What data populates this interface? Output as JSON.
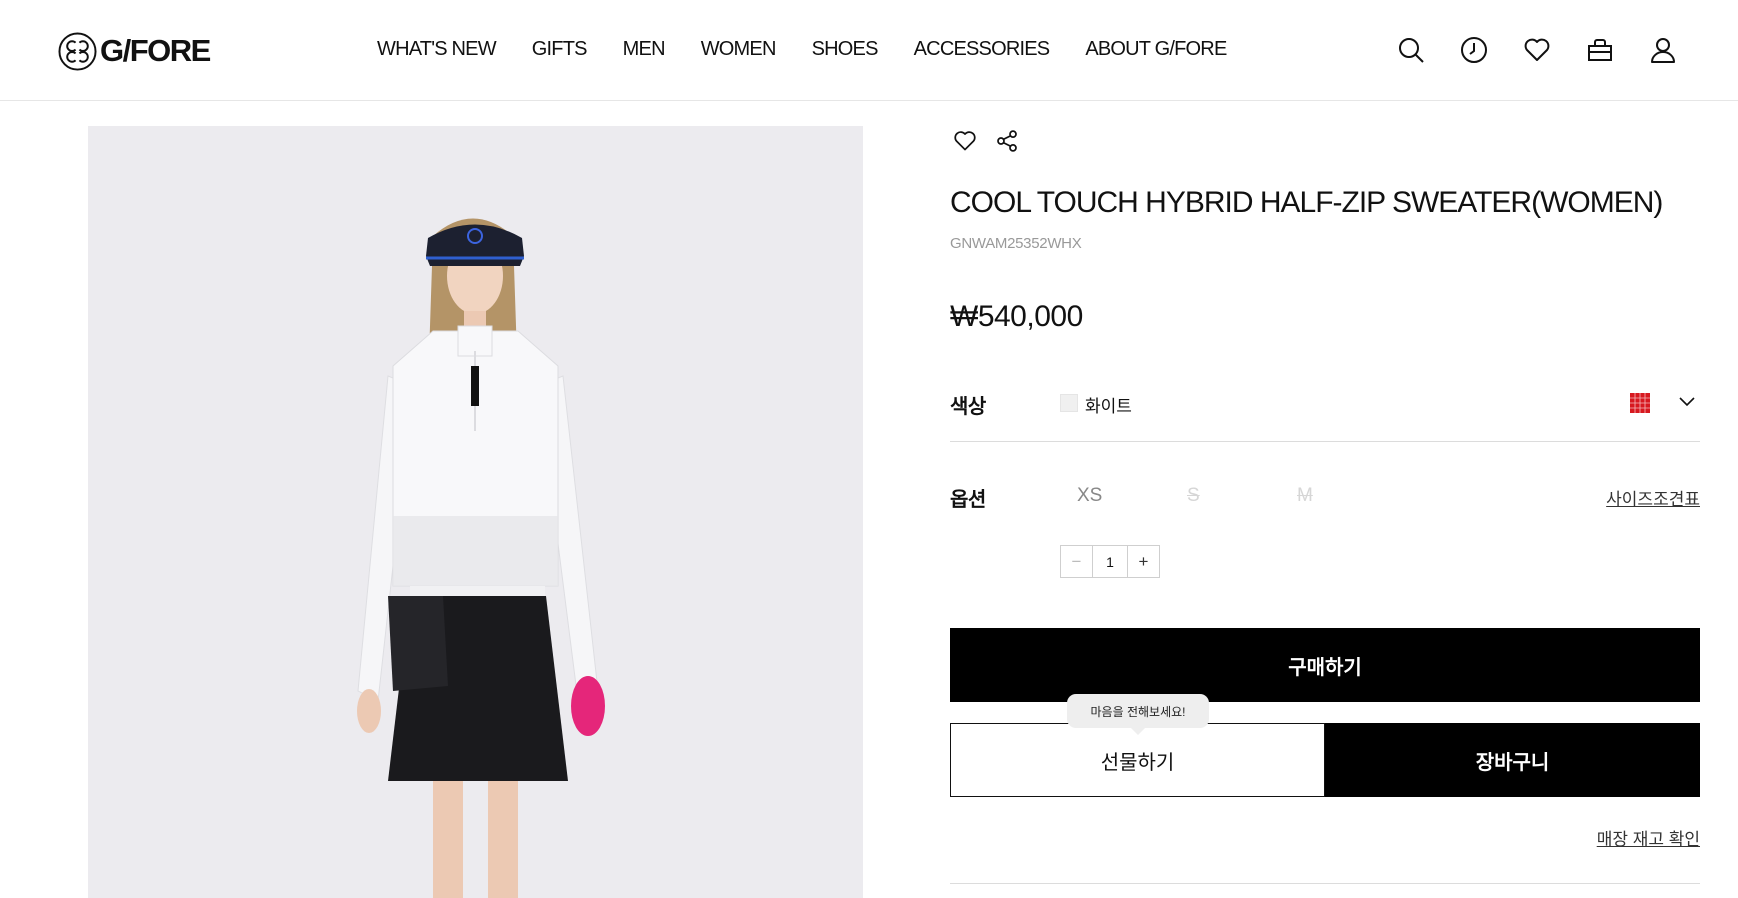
{
  "header": {
    "logo_text": "G/FORE",
    "nav": [
      "WHAT'S NEW",
      "GIFTS",
      "MEN",
      "WOMEN",
      "SHOES",
      "ACCESSORIES",
      "ABOUT G/FORE"
    ],
    "icons": [
      "search-icon",
      "recent-view-icon",
      "wishlist-icon",
      "cart-icon",
      "account-icon"
    ]
  },
  "product": {
    "title": "COOL TOUCH HYBRID HALF-ZIP SWEATER(WOMEN)",
    "code": "GNWAM25352WHX",
    "price": "₩540,000",
    "color": {
      "label": "색상",
      "value": "화이트",
      "swatch_color": "#f0f0f0",
      "chip_color": "#d71920"
    },
    "option": {
      "label": "옵션",
      "sizes": [
        {
          "name": "XS",
          "available": true
        },
        {
          "name": "S",
          "available": false
        },
        {
          "name": "M",
          "available": false
        }
      ],
      "size_guide": "사이즈조견표"
    },
    "quantity": {
      "minus": "−",
      "value": "1",
      "plus": "+"
    },
    "buttons": {
      "buy": "구매하기",
      "gift": "선물하기",
      "cart": "장바구니"
    },
    "gift_tooltip": "마음을 전해보세요!",
    "store_stock": "매장 재고 확인"
  },
  "colors": {
    "brand": "#000000",
    "image_bg": "#ecebef",
    "accent_glove": "#e5267a"
  }
}
